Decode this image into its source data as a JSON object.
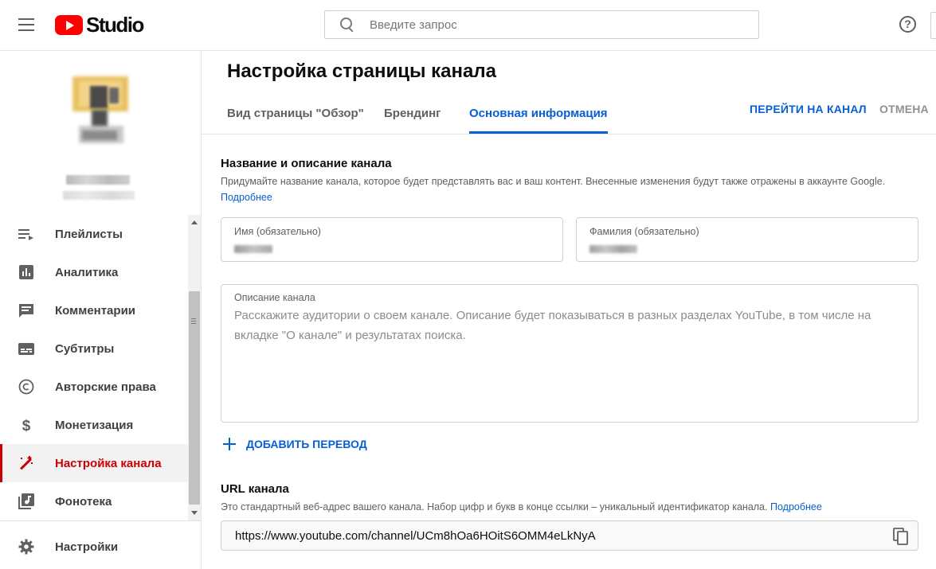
{
  "header": {
    "logo_text": "Studio",
    "search_placeholder": "Введите запрос",
    "help_icon": "?"
  },
  "sidebar": {
    "items": [
      {
        "label": "Плейлисты",
        "icon": "playlist-icon"
      },
      {
        "label": "Аналитика",
        "icon": "analytics-icon"
      },
      {
        "label": "Комментарии",
        "icon": "comments-icon"
      },
      {
        "label": "Субтитры",
        "icon": "subtitles-icon"
      },
      {
        "label": "Авторские права",
        "icon": "copyright-icon"
      },
      {
        "label": "Монетизация",
        "icon": "dollar-icon"
      },
      {
        "label": "Настройка канала",
        "icon": "magic-wand-icon",
        "active": true
      },
      {
        "label": "Фонотека",
        "icon": "audio-library-icon"
      }
    ],
    "settings_label": "Настройки",
    "active_color": "#cc0000"
  },
  "main": {
    "title": "Настройка страницы канала",
    "tabs": [
      {
        "label": "Вид страницы \"Обзор\""
      },
      {
        "label": "Брендинг"
      },
      {
        "label": "Основная информация",
        "active": true
      }
    ],
    "go_to_channel": "ПЕРЕЙТИ НА КАНАЛ",
    "cancel": "ОТМЕНА",
    "name_section": {
      "title": "Название и описание канала",
      "desc": "Придумайте название канала, которое будет представлять вас и ваш контент. Внесенные изменения будут также отражены в аккаунте Google.",
      "link": "Подробнее"
    },
    "first_name_label": "Имя (обязательно)",
    "last_name_label": "Фамилия (обязательно)",
    "description_label": "Описание канала",
    "description_placeholder": "Расскажите аудитории о своем канале. Описание будет показываться в разных разделах YouTube, в том числе на вкладке \"О канале\" и результатах поиска.",
    "add_translation": "ДОБАВИТЬ ПЕРЕВОД",
    "url_section": {
      "title": "URL канала",
      "desc": "Это стандартный веб-адрес вашего канала. Набор цифр и букв в конце ссылки – уникальный идентификатор канала.",
      "link": "Подробнее"
    },
    "channel_url": "https://www.youtube.com/channel/UCm8hOa6HOitS6OMM4eLkNyA",
    "accent_color": "#065fd4"
  }
}
